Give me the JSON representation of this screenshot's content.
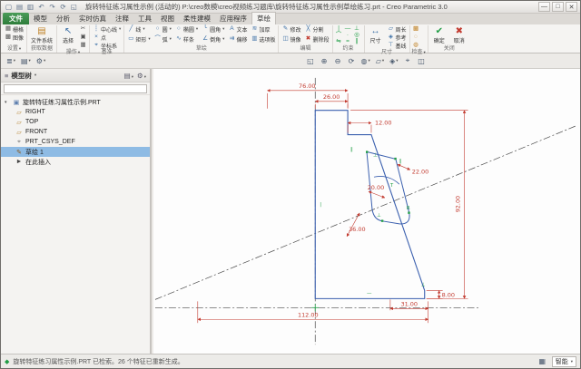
{
  "window": {
    "title": "旋转特征练习属性示例 (活动的) P:\\creo数模\\creo视频练习题库\\旋转特征练习属性示例草绘练习.prt - Creo Parametric 3.0"
  },
  "tabs": {
    "file": "文件",
    "items": [
      {
        "label": "模型"
      },
      {
        "label": "分析"
      },
      {
        "label": "实时仿真"
      },
      {
        "label": "注释"
      },
      {
        "label": "工具"
      },
      {
        "label": "视图"
      },
      {
        "label": "柔性建模"
      },
      {
        "label": "应用程序"
      },
      {
        "label": "草绘",
        "active": true
      }
    ]
  },
  "ribbon": {
    "groups": [
      {
        "name": "设置",
        "buttons": [
          {
            "label": "栅格"
          },
          {
            "label": "图像"
          }
        ]
      },
      {
        "name": "获取数据",
        "buttons": [
          {
            "label": "文件系统"
          }
        ]
      },
      {
        "name": "操作",
        "buttons": [
          {
            "label": "选择"
          }
        ],
        "icons": [
          "cut-icon",
          "copy-icon",
          "paste-icon"
        ]
      },
      {
        "name": "基准",
        "buttons": [
          {
            "label": "中心线"
          },
          {
            "label": "点"
          },
          {
            "label": "坐标系"
          }
        ]
      },
      {
        "name": "草绘",
        "buttons": [
          {
            "label": "线"
          },
          {
            "label": "矩形"
          },
          {
            "label": "圆"
          },
          {
            "label": "弧"
          },
          {
            "label": "椭圆"
          },
          {
            "label": "样条"
          },
          {
            "label": "圆角"
          },
          {
            "label": "倒角"
          },
          {
            "label": "文本"
          },
          {
            "label": "偏移"
          },
          {
            "label": "加厚"
          },
          {
            "label": "选项板"
          }
        ]
      },
      {
        "name": "编辑",
        "buttons": [
          {
            "label": "修改"
          },
          {
            "label": "镜像"
          },
          {
            "label": "分割"
          },
          {
            "label": "删除段"
          }
        ]
      },
      {
        "name": "约束",
        "icons": [
          "vertical-constraint-icon",
          "horizontal-constraint-icon",
          "perpendicular-constraint-icon",
          "tangent-constraint-icon",
          "midpoint-constraint-icon",
          "coincident-constraint-icon",
          "symmetric-constraint-icon",
          "equal-constraint-icon",
          "parallel-constraint-icon"
        ]
      },
      {
        "name": "尺寸",
        "buttons": [
          {
            "label": "尺寸"
          },
          {
            "label": "周长"
          },
          {
            "label": "参考"
          },
          {
            "label": "基线"
          }
        ]
      },
      {
        "name": "检查",
        "icons": [
          "overlapping-geometry-icon",
          "open-ends-icon",
          "shade-closed-loops-icon"
        ]
      },
      {
        "name": "关闭",
        "buttons": [
          {
            "label": "确定"
          },
          {
            "label": "取消"
          }
        ]
      }
    ]
  },
  "graphics_toolbar": {
    "icons": [
      "refit-icon",
      "zoom-in-icon",
      "zoom-out-icon",
      "repaint-icon",
      "display-style-icon",
      "datum-display-icon",
      "annotation-display-icon",
      "spin-center-icon",
      "view-manager-icon"
    ]
  },
  "model_tree": {
    "title": "模型树",
    "items": [
      {
        "label": "旋转特征练习属性示例.PRT",
        "icon": "part-icon"
      },
      {
        "label": "RIGHT",
        "icon": "datum-plane-icon"
      },
      {
        "label": "TOP",
        "icon": "datum-plane-icon"
      },
      {
        "label": "FRONT",
        "icon": "datum-plane-icon"
      },
      {
        "label": "PRT_CSYS_DEF",
        "icon": "csys-icon"
      },
      {
        "label": "草绘 1",
        "icon": "sketch-icon",
        "selected": true
      },
      {
        "label": "在此插入",
        "icon": "insert-here-icon"
      }
    ]
  },
  "status_bar": {
    "message": "旋转特征练习属性示例.PRT 已检索。26 个特征已重新生成。",
    "filter": "智能"
  },
  "sketch": {
    "dims": {
      "d76": "76.00",
      "d26": "26.00",
      "d12": "12.00",
      "d22": "22.00",
      "d20": "20.00",
      "d36": "36.00",
      "d92": "92.00",
      "d112": "112.00",
      "d31": "31.00",
      "d8": "8.00"
    },
    "constraints": [
      "∥",
      "⊥",
      "∥",
      "T",
      "R",
      "⊥",
      "|",
      "—",
      "⊥"
    ]
  }
}
